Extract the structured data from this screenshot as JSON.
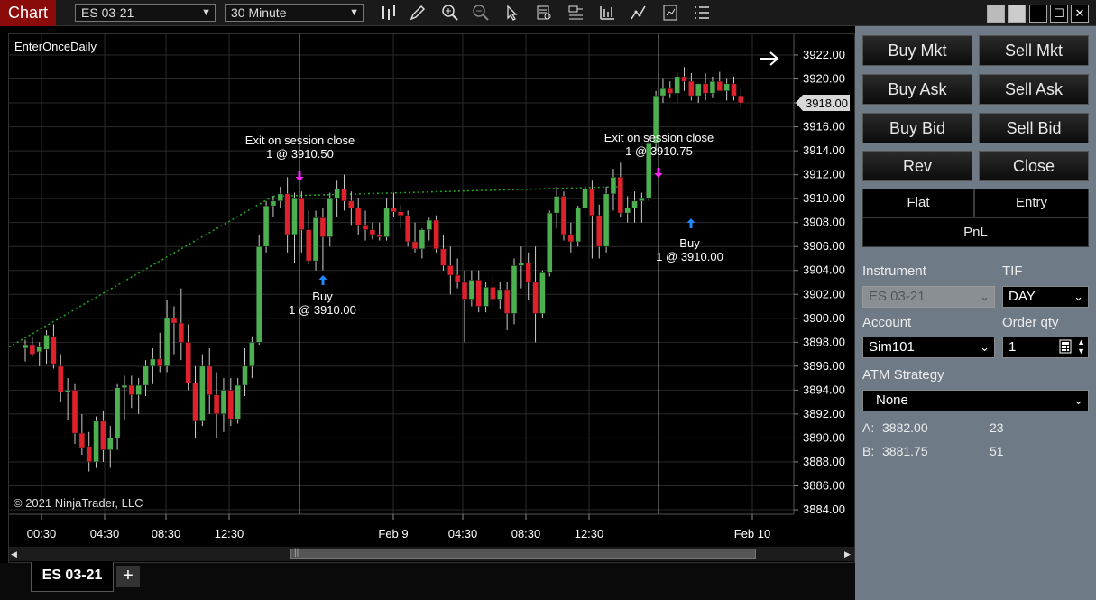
{
  "window": {
    "title": "Chart"
  },
  "toolbar": {
    "instrument": "ES 03-21",
    "interval": "30 Minute",
    "icons": [
      "bars-type-icon",
      "draw-pencil-icon",
      "zoom-in-icon",
      "zoom-out-icon",
      "cursor-icon",
      "data-box-icon",
      "templates-icon",
      "bar-chart-icon",
      "line-draw-icon",
      "strategies-icon",
      "properties-icon"
    ]
  },
  "chart": {
    "strategy_label": "EnterOnceDaily",
    "copyright": "© 2021 NinjaTrader, LLC",
    "price_ticks": [
      "3922.00",
      "3920.00",
      "3918.00",
      "3916.00",
      "3914.00",
      "3912.00",
      "3910.00",
      "3908.00",
      "3906.00",
      "3904.00",
      "3902.00",
      "3900.00",
      "3898.00",
      "3896.00",
      "3894.00",
      "3892.00",
      "3890.00",
      "3888.00",
      "3886.00",
      "3884.00"
    ],
    "last_price": "3918.00",
    "time_labels": [
      "00:30",
      "04:30",
      "08:30",
      "12:30",
      "Feb 9",
      "04:30",
      "08:30",
      "12:30",
      "Feb 10"
    ],
    "annotations": {
      "exit1_line1": "Exit on session close",
      "exit1_line2": "1 @ 3910.50",
      "buy1_line1": "Buy",
      "buy1_line2": "1 @ 3910.00",
      "exit2_line1": "Exit on session close",
      "exit2_line2": "1 @ 3910.75",
      "buy2_line1": "Buy",
      "buy2_line2": "1 @ 3910.00"
    },
    "colors": {
      "up": "#4caf50",
      "down": "#e0202a",
      "wick": "#cccccc",
      "grid": "#2a2a2a",
      "trade_line": "#22aa22",
      "buy_arrow": "#1e88ff",
      "exit_arrow": "#ff22ff"
    }
  },
  "chart_data": {
    "type": "candlestick",
    "instrument": "ES 03-21",
    "interval": "30 Minute",
    "ylim": [
      3884,
      3922
    ],
    "ohlc": [
      [
        3897.5,
        3898.2,
        3896.4,
        3897.8
      ],
      [
        3897.8,
        3898.4,
        3896.8,
        3897.0
      ],
      [
        3897.2,
        3898.0,
        3896.0,
        3897.6
      ],
      [
        3897.4,
        3899.0,
        3896.2,
        3898.6
      ],
      [
        3898.5,
        3899.5,
        3895.8,
        3896.2
      ],
      [
        3896.0,
        3897.0,
        3893.0,
        3893.8
      ],
      [
        3893.8,
        3895.0,
        3891.5,
        3894.0
      ],
      [
        3894.0,
        3894.5,
        3889.5,
        3890.4
      ],
      [
        3890.4,
        3892.0,
        3888.6,
        3889.2
      ],
      [
        3889.3,
        3890.5,
        3887.2,
        3888.0
      ],
      [
        3888.0,
        3891.8,
        3887.5,
        3891.4
      ],
      [
        3891.4,
        3892.3,
        3888.0,
        3889.0
      ],
      [
        3889.0,
        3891.0,
        3887.5,
        3890.0
      ],
      [
        3890.0,
        3894.5,
        3889.0,
        3894.2
      ],
      [
        3894.2,
        3895.2,
        3891.5,
        3894.4
      ],
      [
        3894.4,
        3895.2,
        3892.5,
        3893.6
      ],
      [
        3893.6,
        3895.0,
        3892.0,
        3894.4
      ],
      [
        3894.4,
        3896.5,
        3893.5,
        3896.0
      ],
      [
        3896.0,
        3897.5,
        3894.5,
        3896.6
      ],
      [
        3896.6,
        3898.8,
        3895.5,
        3896.0
      ],
      [
        3896.0,
        3901.5,
        3895.5,
        3900.0
      ],
      [
        3900.0,
        3901.0,
        3897.0,
        3899.6
      ],
      [
        3899.6,
        3902.5,
        3896.5,
        3898.0
      ],
      [
        3898.0,
        3899.5,
        3894.0,
        3894.6
      ],
      [
        3894.6,
        3896.0,
        3890.0,
        3891.4
      ],
      [
        3891.4,
        3897.0,
        3891.0,
        3896.0
      ],
      [
        3896.0,
        3897.5,
        3892.0,
        3893.6
      ],
      [
        3893.6,
        3895.5,
        3890.0,
        3892.0
      ],
      [
        3892.0,
        3895.0,
        3890.5,
        3894.0
      ],
      [
        3894.0,
        3895.0,
        3891.0,
        3891.6
      ],
      [
        3891.6,
        3895.0,
        3891.2,
        3894.4
      ],
      [
        3894.4,
        3897.5,
        3893.5,
        3896.0
      ],
      [
        3896.0,
        3898.5,
        3895.0,
        3898.0
      ],
      [
        3898.0,
        3907.0,
        3897.8,
        3906.0
      ],
      [
        3906.0,
        3909.8,
        3905.5,
        3909.4
      ],
      [
        3909.4,
        3910.2,
        3908.5,
        3909.8
      ],
      [
        3909.8,
        3911.0,
        3909.2,
        3910.4
      ],
      [
        3910.4,
        3911.8,
        3905.5,
        3907.0
      ],
      [
        3907.0,
        3910.5,
        3904.6,
        3910.0
      ],
      [
        3910.0,
        3910.6,
        3905.5,
        3907.4
      ],
      [
        3907.4,
        3909.0,
        3904.5,
        3904.8
      ],
      [
        3904.8,
        3909.0,
        3904.0,
        3908.4
      ],
      [
        3908.4,
        3909.2,
        3904.0,
        3906.8
      ],
      [
        3906.8,
        3910.5,
        3906.0,
        3910.0
      ],
      [
        3910.0,
        3911.5,
        3908.5,
        3910.8
      ],
      [
        3910.8,
        3912.0,
        3909.0,
        3909.8
      ],
      [
        3909.8,
        3910.6,
        3907.8,
        3909.2
      ],
      [
        3909.2,
        3910.0,
        3907.0,
        3907.8
      ],
      [
        3907.8,
        3909.0,
        3906.5,
        3907.4
      ],
      [
        3907.4,
        3908.0,
        3906.6,
        3907.0
      ],
      [
        3907.0,
        3908.0,
        3906.5,
        3906.8
      ],
      [
        3906.8,
        3910.0,
        3906.5,
        3909.2
      ],
      [
        3909.2,
        3910.5,
        3908.5,
        3908.9
      ],
      [
        3908.9,
        3909.5,
        3907.5,
        3908.6
      ],
      [
        3908.6,
        3909.0,
        3906.0,
        3906.4
      ],
      [
        3906.4,
        3908.0,
        3905.5,
        3905.8
      ],
      [
        3905.8,
        3907.5,
        3905.0,
        3907.4
      ],
      [
        3907.4,
        3908.4,
        3906.5,
        3908.2
      ],
      [
        3908.2,
        3908.6,
        3905.5,
        3905.8
      ],
      [
        3905.8,
        3907.0,
        3904.0,
        3904.4
      ],
      [
        3904.4,
        3906.0,
        3902.0,
        3903.6
      ],
      [
        3903.6,
        3905.0,
        3902.5,
        3903.0
      ],
      [
        3903.0,
        3904.0,
        3898.0,
        3901.6
      ],
      [
        3901.6,
        3904.0,
        3901.0,
        3903.2
      ],
      [
        3903.2,
        3904.0,
        3900.5,
        3901.0
      ],
      [
        3901.0,
        3903.0,
        3900.5,
        3902.6
      ],
      [
        3902.6,
        3903.5,
        3901.0,
        3901.6
      ],
      [
        3901.6,
        3903.0,
        3900.8,
        3902.4
      ],
      [
        3902.4,
        3903.0,
        3899.0,
        3900.4
      ],
      [
        3900.4,
        3905.0,
        3899.5,
        3904.4
      ],
      [
        3904.4,
        3906.0,
        3902.5,
        3904.6
      ],
      [
        3904.6,
        3905.5,
        3901.5,
        3903.0
      ],
      [
        3903.0,
        3906.0,
        3898.0,
        3900.4
      ],
      [
        3900.4,
        3904.0,
        3900.0,
        3903.8
      ],
      [
        3903.8,
        3909.0,
        3903.5,
        3908.8
      ],
      [
        3908.8,
        3911.0,
        3907.5,
        3910.2
      ],
      [
        3910.2,
        3910.6,
        3906.5,
        3907.0
      ],
      [
        3907.0,
        3908.0,
        3905.5,
        3906.4
      ],
      [
        3906.4,
        3909.4,
        3906.0,
        3909.2
      ],
      [
        3909.2,
        3911.0,
        3908.5,
        3910.8
      ],
      [
        3910.8,
        3911.5,
        3905.0,
        3908.6
      ],
      [
        3908.6,
        3909.5,
        3905.0,
        3906.0
      ],
      [
        3906.0,
        3911.0,
        3905.5,
        3910.4
      ],
      [
        3910.4,
        3912.5,
        3909.0,
        3911.8
      ],
      [
        3911.8,
        3913.0,
        3908.5,
        3908.8
      ],
      [
        3908.8,
        3910.2,
        3908.0,
        3909.2
      ],
      [
        3909.2,
        3910.6,
        3908.0,
        3909.8
      ],
      [
        3909.8,
        3910.5,
        3908.0,
        3910.0
      ],
      [
        3910.0,
        3915.0,
        3909.8,
        3914.6
      ],
      [
        3914.6,
        3919.0,
        3914.0,
        3918.6
      ],
      [
        3918.6,
        3920.0,
        3918.0,
        3919.2
      ],
      [
        3919.2,
        3919.8,
        3918.4,
        3918.8
      ],
      [
        3918.8,
        3920.6,
        3918.0,
        3920.2
      ],
      [
        3920.2,
        3921.0,
        3919.0,
        3919.8
      ],
      [
        3919.8,
        3920.5,
        3918.2,
        3918.6
      ],
      [
        3918.6,
        3919.5,
        3918.0,
        3919.6
      ],
      [
        3919.6,
        3920.5,
        3918.2,
        3918.8
      ],
      [
        3918.8,
        3920.2,
        3918.4,
        3919.8
      ],
      [
        3919.8,
        3920.6,
        3919.0,
        3919.0
      ],
      [
        3919.0,
        3920.0,
        3918.2,
        3919.6
      ],
      [
        3919.6,
        3920.2,
        3918.2,
        3918.6
      ],
      [
        3918.6,
        3919.2,
        3917.6,
        3918.0
      ]
    ]
  },
  "side": {
    "buttons": [
      [
        "Buy Mkt",
        "Sell Mkt"
      ],
      [
        "Buy Ask",
        "Sell Ask"
      ],
      [
        "Buy Bid",
        "Sell Bid"
      ],
      [
        "Rev",
        "Close"
      ]
    ],
    "flat": "Flat",
    "entry": "Entry",
    "pnl": "PnL",
    "instrument_label": "Instrument",
    "instrument_value": "ES 03-21",
    "tif_label": "TIF",
    "tif_value": "DAY",
    "account_label": "Account",
    "account_value": "Sim101",
    "qty_label": "Order qty",
    "qty_value": "1",
    "atm_label": "ATM Strategy",
    "atm_value": "None",
    "ask_label": "A:",
    "ask_price": "3882.00",
    "ask_size": "23",
    "bid_label": "B:",
    "bid_price": "3881.75",
    "bid_size": "51"
  },
  "tabs": {
    "active": "ES 03-21",
    "add": "+"
  }
}
